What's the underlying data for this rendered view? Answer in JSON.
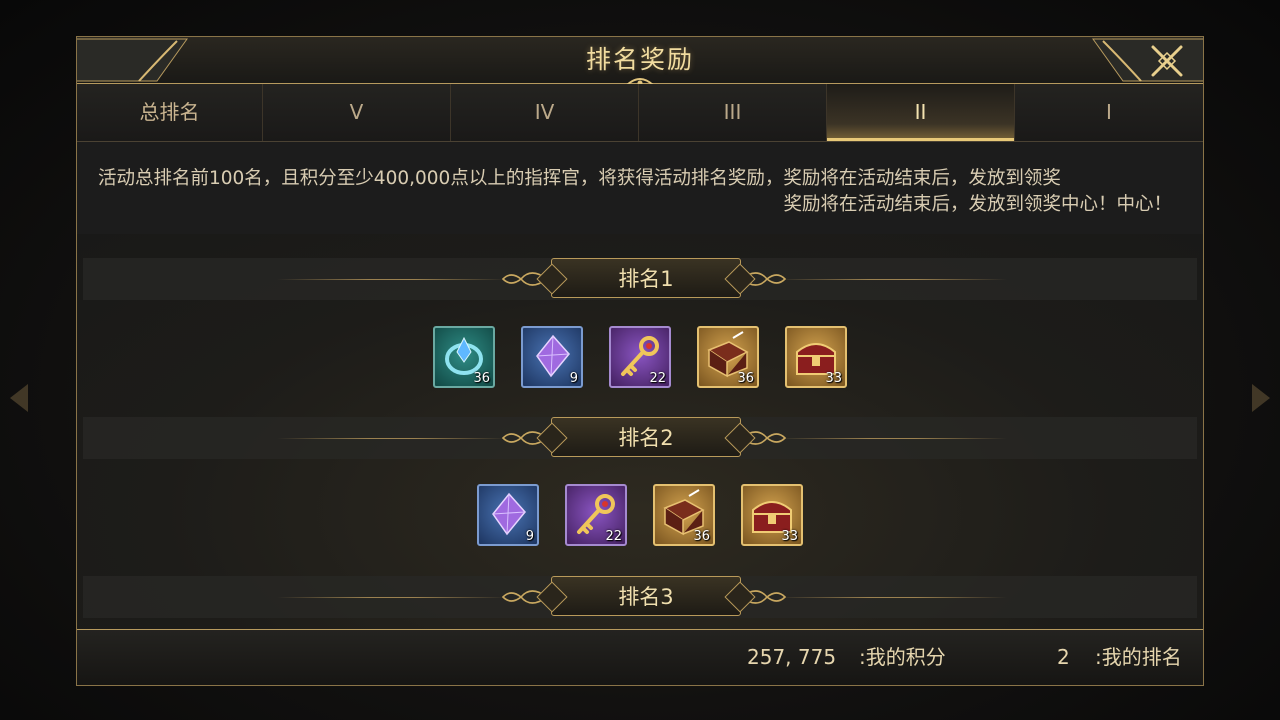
{
  "header": {
    "title": "排名奖励",
    "close_icon": "close-x-icon"
  },
  "tabs": [
    {
      "label": "总排名",
      "active": false
    },
    {
      "label": "V",
      "active": false
    },
    {
      "label": "IV",
      "active": false
    },
    {
      "label": "III",
      "active": false
    },
    {
      "label": "II",
      "active": true
    },
    {
      "label": "I",
      "active": false
    }
  ],
  "description": {
    "line1": "活动总排名前100名，且积分至少400,000点以上的指挥官，将获得活动排名奖励，奖励将在活动结束后，发放到领奖",
    "line2": "奖励将在活动结束后，发放到领奖中心！中心！"
  },
  "ranks": [
    {
      "label": "排名1",
      "rewards": [
        {
          "icon": "teal-ring-gem-icon",
          "bg": "teal",
          "qty": "36"
        },
        {
          "icon": "purple-crystal-icon",
          "bg": "blue",
          "qty": "9"
        },
        {
          "icon": "golden-key-icon",
          "bg": "purple",
          "qty": "22"
        },
        {
          "icon": "scroll-book-icon",
          "bg": "gold",
          "qty": "36"
        },
        {
          "icon": "red-treasure-chest-icon",
          "bg": "gold",
          "qty": "33"
        }
      ]
    },
    {
      "label": "排名2",
      "rewards": [
        {
          "icon": "purple-crystal-icon",
          "bg": "blue",
          "qty": "9"
        },
        {
          "icon": "golden-key-icon",
          "bg": "purple",
          "qty": "22"
        },
        {
          "icon": "scroll-book-icon",
          "bg": "gold",
          "qty": "36"
        },
        {
          "icon": "red-treasure-chest-icon",
          "bg": "gold",
          "qty": "33"
        }
      ]
    },
    {
      "label": "排名3",
      "rewards": []
    }
  ],
  "footer": {
    "score_value": "257, 775",
    "score_label": ":我的积分",
    "rank_value": "2",
    "rank_label": ":我的排名"
  },
  "colors": {
    "accent_gold": "#e8c978",
    "frame": "#8a7448",
    "panel_bg": "#1b1b1a"
  }
}
